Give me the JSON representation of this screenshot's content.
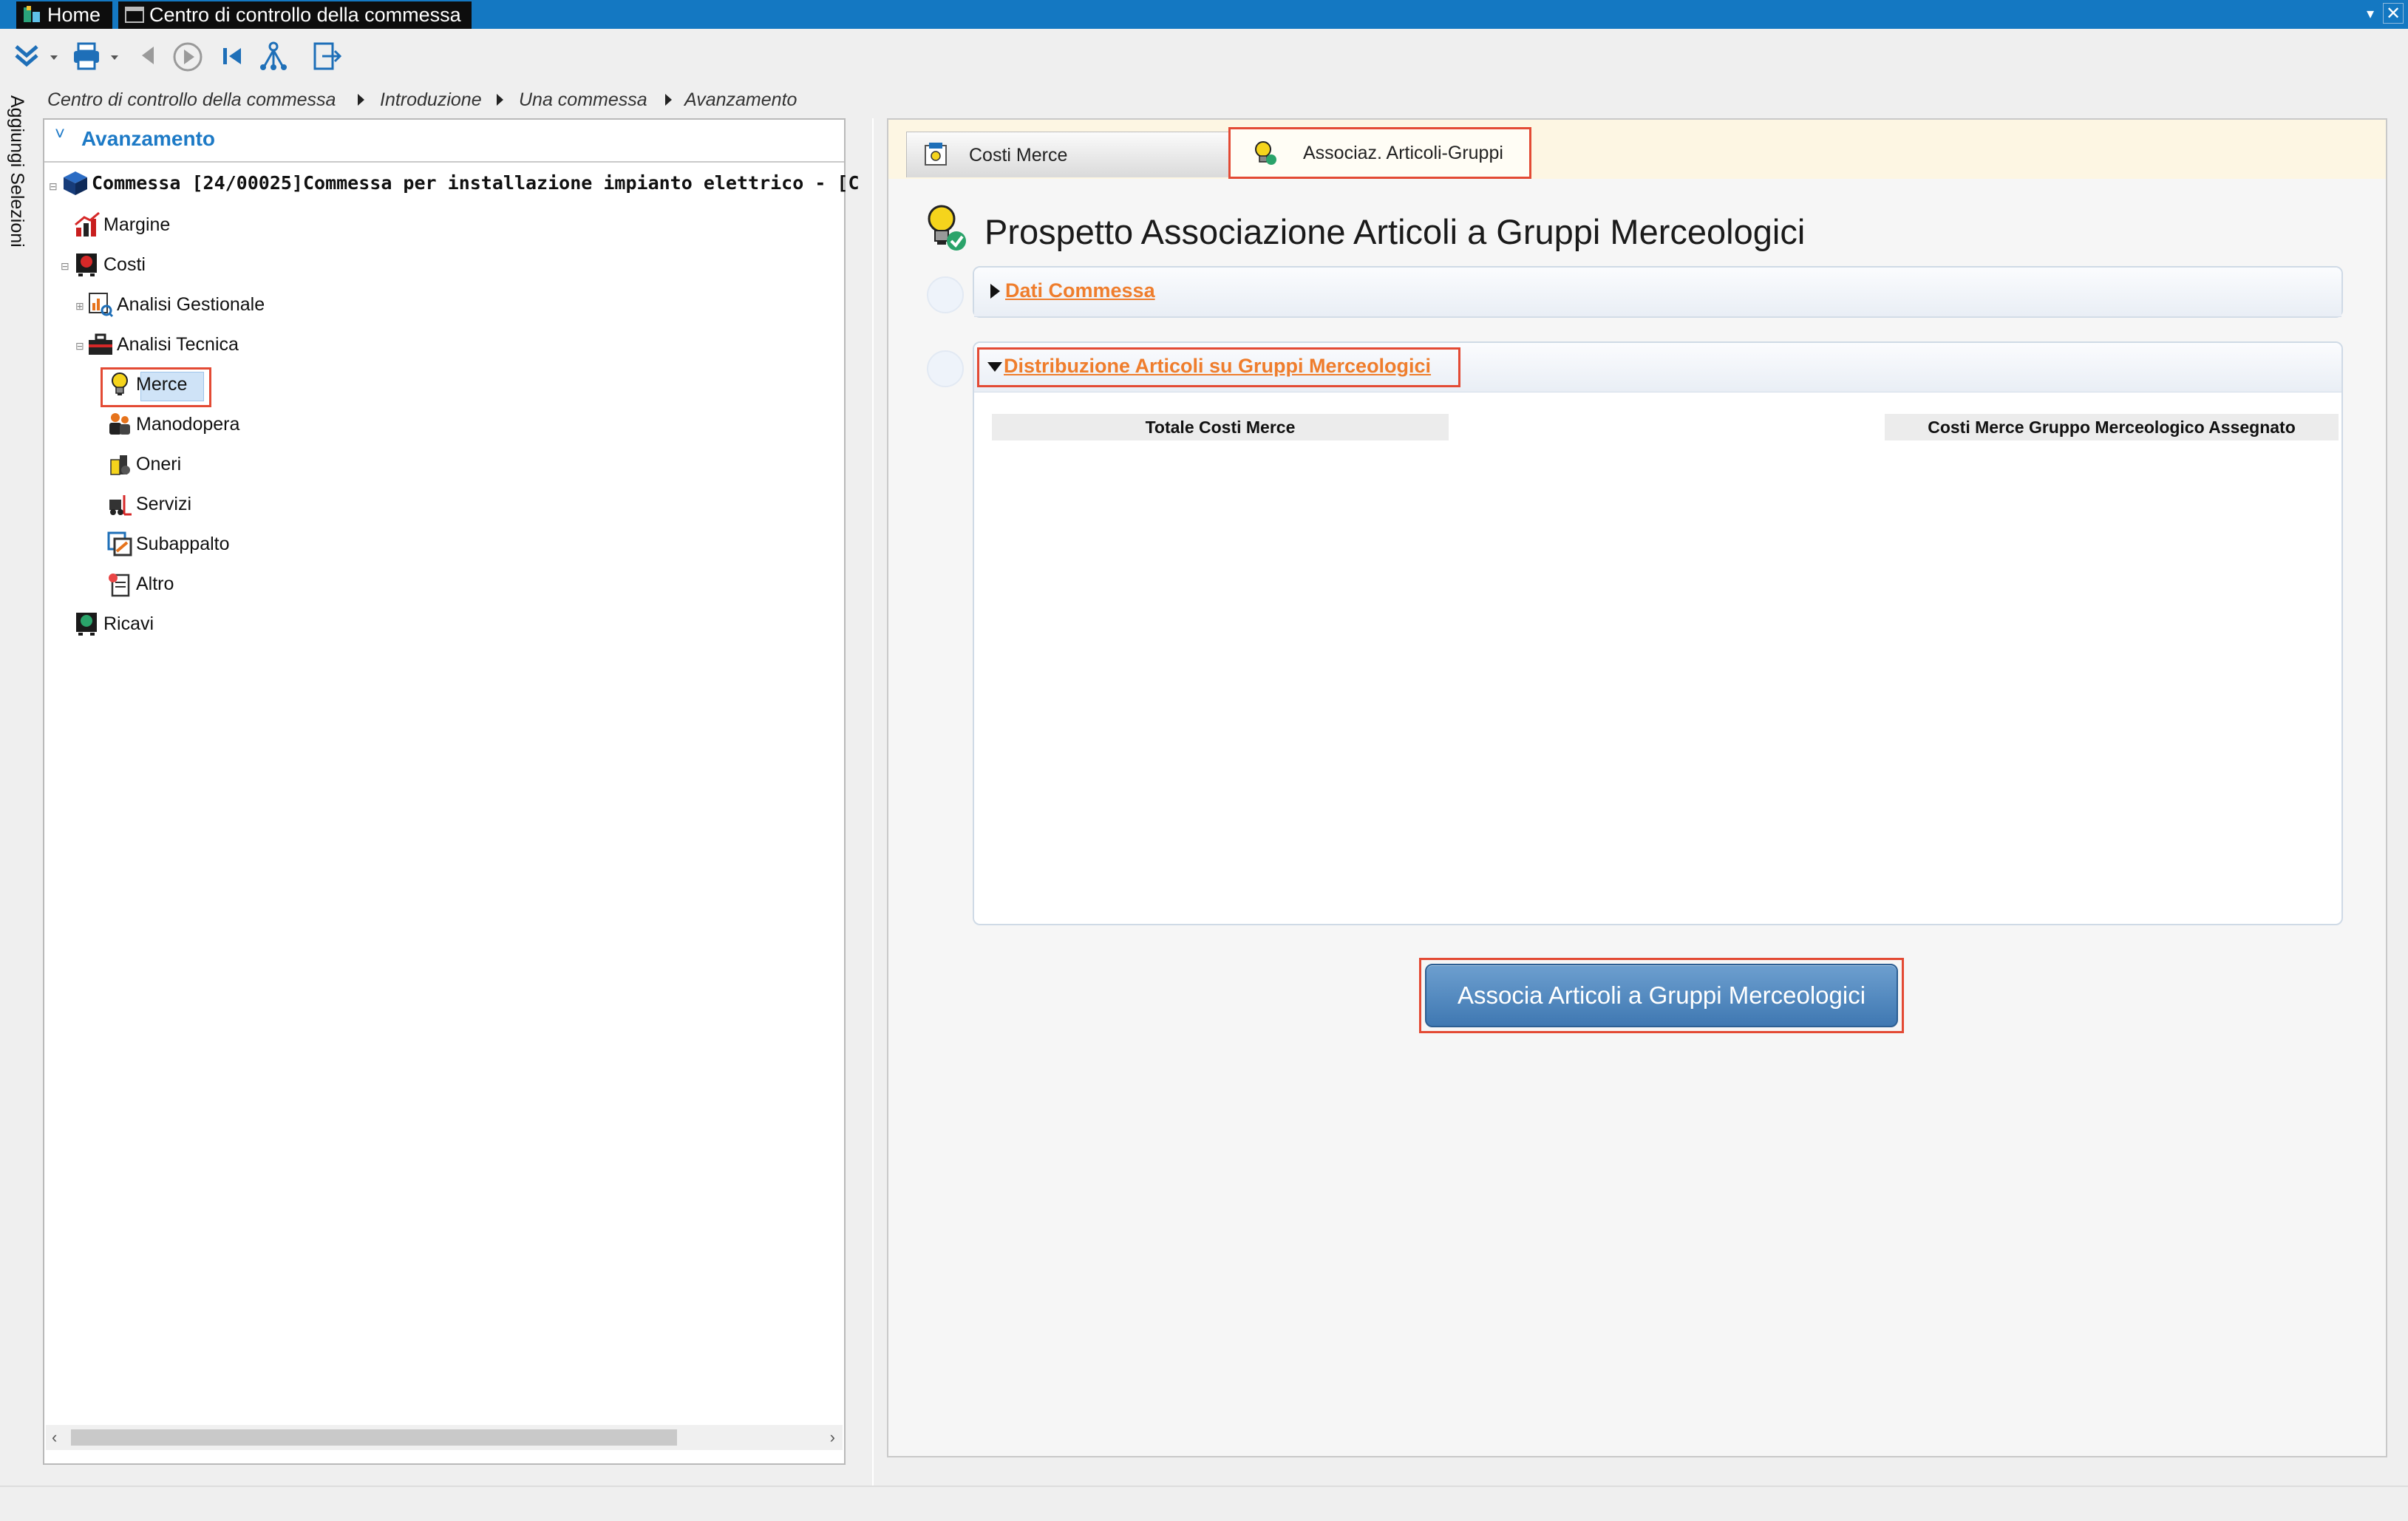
{
  "titlebar": {
    "tab_home": "Home",
    "tab_window": "Centro di controllo della commessa",
    "dropdown_glyph": "▾",
    "close_glyph": "✕"
  },
  "toolbar": {
    "icons": [
      "expand-collapse-icon",
      "print-icon",
      "back-icon",
      "play-icon",
      "first-icon",
      "hierarchy-icon",
      "exit-icon"
    ]
  },
  "siderail": {
    "label": "Aggiungi Selezioni"
  },
  "breadcrumb": [
    "Centro di controllo della commessa",
    "Introduzione",
    "Una commessa",
    "Avanzamento"
  ],
  "leftpanel": {
    "title": "Avanzamento",
    "tree": {
      "root": "Commessa [24/00025]Commessa per installazione impianto elettrico - [C",
      "margine": "Margine",
      "costi": "Costi",
      "analisi_gestionale": "Analisi Gestionale",
      "analisi_tecnica": "Analisi Tecnica",
      "merce": "Merce",
      "manodopera": "Manodopera",
      "oneri": "Oneri",
      "servizi": "Servizi",
      "subappalto": "Subappalto",
      "altro": "Altro",
      "ricavi": "Ricavi"
    },
    "scroll_left": "‹",
    "scroll_right": "›"
  },
  "rightpanel": {
    "tabs": [
      {
        "label": "Costi Merce"
      },
      {
        "label": "Associaz. Articoli-Gruppi"
      }
    ],
    "page_title": "Prospetto Associazione Articoli a Gruppi Merceologici",
    "section1": {
      "label": "Dati Commessa"
    },
    "section2": {
      "label": "Distribuzione Articoli su Gruppi Merceologici",
      "columns": [
        "Totale Costi Merce",
        "Costi Merce Gruppo Merceologico Assegnato"
      ]
    },
    "action_button": "Associa Articoli a Gruppi Merceologici"
  },
  "colors": {
    "titlebar": "#1478c2",
    "accent_blue": "#1d7ac6",
    "link_orange": "#ef7d2c",
    "highlight_red": "#e34a34",
    "button_blue": "#3f78b2"
  }
}
